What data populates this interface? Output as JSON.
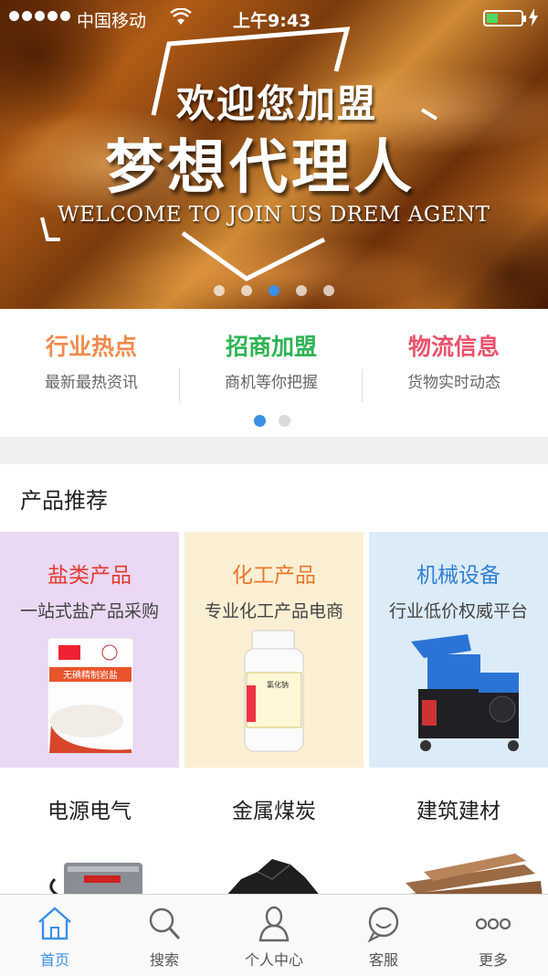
{
  "status_bar": {
    "carrier": "中国移动",
    "time": "上午9:43"
  },
  "banner": {
    "welcome": "欢迎您加盟",
    "title": "梦想代理人",
    "subtitle": "WELCOME TO JOIN US DREM AGENT",
    "slide_count": 5,
    "active_slide": 3
  },
  "categories": [
    {
      "title": "行业热点",
      "subtitle": "最新最热资讯",
      "color": "#f08a4b"
    },
    {
      "title": "招商加盟",
      "subtitle": "商机等你把握",
      "color": "#2fb355"
    },
    {
      "title": "物流信息",
      "subtitle": "货物实时动态",
      "color": "#e8526b"
    }
  ],
  "section_title": "产品推荐",
  "products": [
    {
      "title": "盐类产品",
      "subtitle": "一站式盐产品采购",
      "title_color": "#e03b2e",
      "bg": "#ead8f5"
    },
    {
      "title": "化工产品",
      "subtitle": "专业化工产品电商",
      "title_color": "#e8772d",
      "bg": "#fbefd3"
    },
    {
      "title": "机械设备",
      "subtitle": "行业低价权威平台",
      "title_color": "#2f7fd0",
      "bg": "#dcebf8"
    },
    {
      "title": "电源电气"
    },
    {
      "title": "金属煤炭"
    },
    {
      "title": "建筑建材"
    }
  ],
  "tabs": [
    {
      "label": "首页",
      "icon": "home-icon",
      "active": true
    },
    {
      "label": "搜索",
      "icon": "search-icon",
      "active": false
    },
    {
      "label": "个人中心",
      "icon": "person-icon",
      "active": false
    },
    {
      "label": "客服",
      "icon": "chat-icon",
      "active": false
    },
    {
      "label": "更多",
      "icon": "more-icon",
      "active": false
    }
  ],
  "accent_color": "#3b8fe6"
}
